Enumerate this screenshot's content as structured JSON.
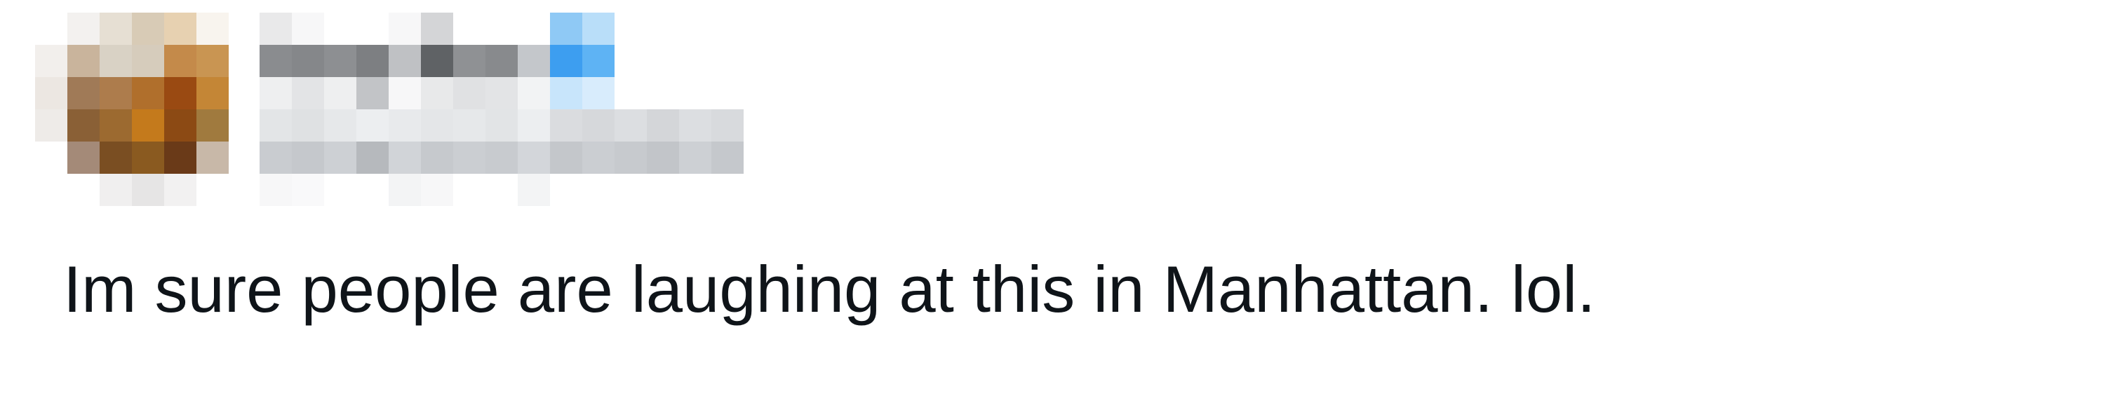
{
  "tweet": {
    "author": {
      "avatar": "pixelated-avatar",
      "identity": "pixelated-redacted"
    },
    "text": "Im sure people are laughing at this in Manhattan. lol."
  },
  "colors": {
    "background": "#ffffff",
    "text": "#0f1419",
    "verified_badge": "#1d9bf0"
  }
}
